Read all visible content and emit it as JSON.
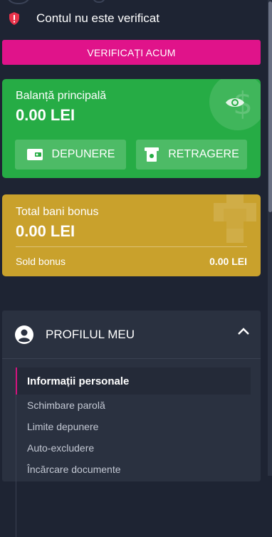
{
  "status": {
    "text": "Contul nu este verificat",
    "icon": "shield-alert-icon",
    "icon_color": "#e8324a"
  },
  "verify_button": {
    "label": "VERIFICAȚI ACUM",
    "color": "#e0138a"
  },
  "main_balance": {
    "label": "Balanță principală",
    "amount": "0.00 LEI",
    "color": "#26ac45",
    "eye_icon": "eye-icon",
    "deposit_label": "DEPUNERE",
    "withdraw_label": "RETRAGERE"
  },
  "bonus_balance": {
    "label": "Total bani bonus",
    "amount": "0.00 LEI",
    "color": "#c9a12c",
    "sold_label": "Sold bonus",
    "sold_value": "0.00 LEI"
  },
  "profile": {
    "title": "PROFILUL MEU",
    "items": [
      {
        "label": "Informații personale",
        "active": true
      },
      {
        "label": "Schimbare parolă",
        "active": false
      },
      {
        "label": "Limite depunere",
        "active": false
      },
      {
        "label": "Auto-excludere",
        "active": false
      },
      {
        "label": "Încărcare documente",
        "active": false
      }
    ],
    "accent_color": "#d5137f"
  }
}
